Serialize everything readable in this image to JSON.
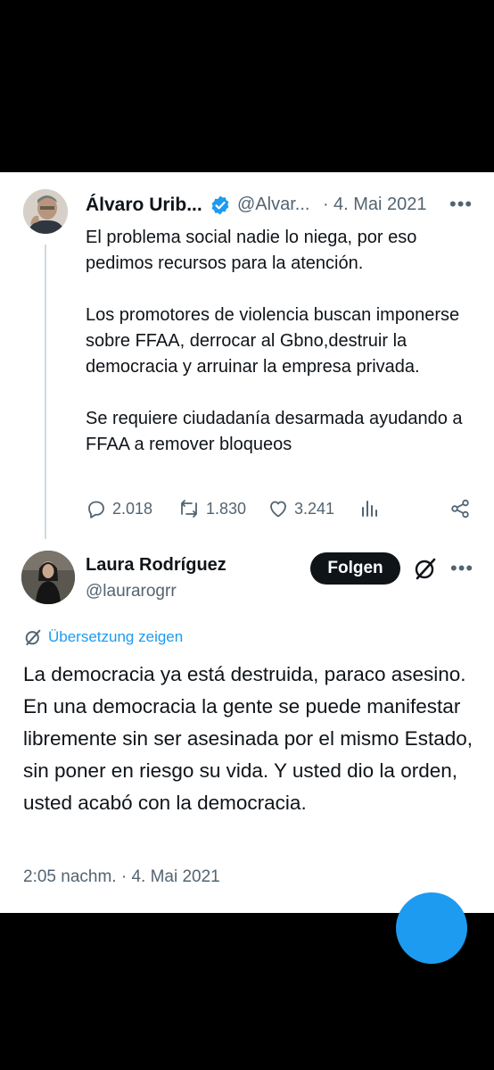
{
  "quoted_tweet": {
    "author_name": "Álvaro Urib...",
    "handle": "@Alvar...",
    "separator": "·",
    "date": "4. Mai 2021",
    "paragraphs": [
      "El problema social nadie lo niega, por eso pedimos recursos para la atención.",
      "Los promotores de violencia buscan imponerse sobre FFAA, derrocar al Gbno,destruir la democracia y arruinar la empresa privada.",
      "Se requiere ciudadanía desarmada ayudando a FFAA a remover bloqueos"
    ],
    "actions": {
      "replies": "2.018",
      "reposts": "1.830",
      "likes": "3.241"
    }
  },
  "reply": {
    "author_name": "Laura Rodríguez",
    "handle": "@laurarogrr",
    "follow_label": "Folgen",
    "translate_label": "Übersetzung zeigen",
    "text": "La democracia ya está destruida, paraco asesino. En una democracia la gente se puede manifestar libremente sin ser asesinada por el mismo Estado, sin poner en riesgo su vida. Y usted dio la orden, usted acabó con la democracia.",
    "timestamp": "2:05 nachm. · 4. Mai 2021"
  },
  "colors": {
    "accent": "#1d9bf0",
    "text_primary": "#0f1419",
    "text_secondary": "#536471",
    "thread_line": "#cfd9de"
  },
  "icons": [
    "verified-badge-icon",
    "more-icon",
    "reply-icon",
    "repost-icon",
    "like-icon",
    "views-icon",
    "share-icon",
    "grok-icon",
    "translate-icon"
  ]
}
